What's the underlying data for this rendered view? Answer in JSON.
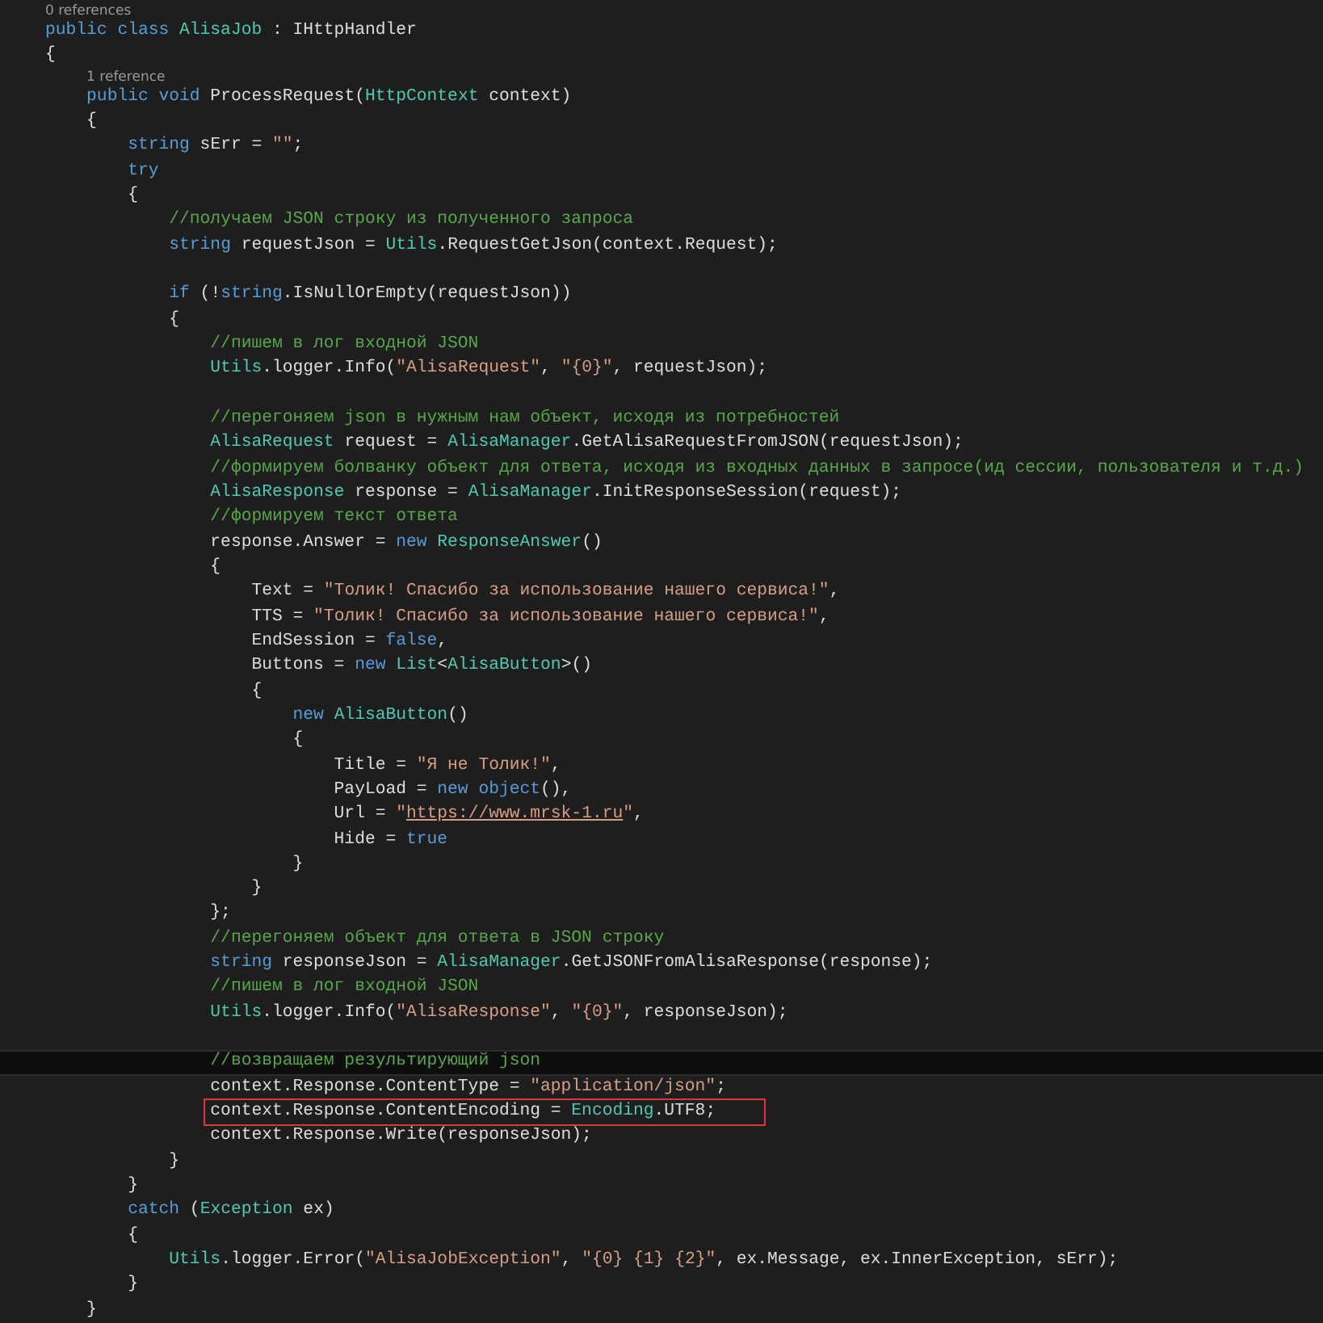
{
  "editor": {
    "lines": [
      {
        "kind": "codelens",
        "text": "0 references"
      },
      {
        "kind": "code",
        "current": false,
        "boxed": false,
        "tokens": [
          {
            "kind": "keyword",
            "text": "public class "
          },
          {
            "kind": "type",
            "text": "AlisaJob"
          },
          {
            "kind": "plain",
            "text": " : IHttpHandler"
          }
        ]
      },
      {
        "kind": "code",
        "current": false,
        "boxed": false,
        "tokens": [
          {
            "kind": "plain",
            "text": "{"
          }
        ]
      },
      {
        "kind": "codelens",
        "text": "    1 reference"
      },
      {
        "kind": "code",
        "current": false,
        "boxed": false,
        "tokens": [
          {
            "kind": "keyword",
            "text": "    public void"
          },
          {
            "kind": "plain",
            "text": " ProcessRequest("
          },
          {
            "kind": "type",
            "text": "HttpContext"
          },
          {
            "kind": "plain",
            "text": " context)"
          }
        ]
      },
      {
        "kind": "code",
        "current": false,
        "boxed": false,
        "tokens": [
          {
            "kind": "plain",
            "text": "    {"
          }
        ]
      },
      {
        "kind": "code",
        "current": false,
        "boxed": false,
        "tokens": [
          {
            "kind": "keyword",
            "text": "        string"
          },
          {
            "kind": "plain",
            "text": " sErr = "
          },
          {
            "kind": "string",
            "text": "\"\""
          },
          {
            "kind": "plain",
            "text": ";"
          }
        ]
      },
      {
        "kind": "code",
        "current": false,
        "boxed": false,
        "tokens": [
          {
            "kind": "keyword",
            "text": "        try"
          }
        ]
      },
      {
        "kind": "code",
        "current": false,
        "boxed": false,
        "tokens": [
          {
            "kind": "plain",
            "text": "        {"
          }
        ]
      },
      {
        "kind": "code",
        "current": false,
        "boxed": false,
        "tokens": [
          {
            "kind": "comment",
            "text": "            //получаем JSON строку из полученного запроса"
          }
        ]
      },
      {
        "kind": "code",
        "current": false,
        "boxed": false,
        "tokens": [
          {
            "kind": "keyword",
            "text": "            string"
          },
          {
            "kind": "plain",
            "text": " requestJson = "
          },
          {
            "kind": "type",
            "text": "Utils"
          },
          {
            "kind": "plain",
            "text": ".RequestGetJson(context.Request);"
          }
        ]
      },
      {
        "kind": "blank"
      },
      {
        "kind": "code",
        "current": false,
        "boxed": false,
        "tokens": [
          {
            "kind": "keyword",
            "text": "            if"
          },
          {
            "kind": "plain",
            "text": " (!"
          },
          {
            "kind": "keyword",
            "text": "string"
          },
          {
            "kind": "plain",
            "text": ".IsNullOrEmpty(requestJson))"
          }
        ]
      },
      {
        "kind": "code",
        "current": false,
        "boxed": false,
        "tokens": [
          {
            "kind": "plain",
            "text": "            {"
          }
        ]
      },
      {
        "kind": "code",
        "current": false,
        "boxed": false,
        "tokens": [
          {
            "kind": "comment",
            "text": "                //пишем в лог входной JSON"
          }
        ]
      },
      {
        "kind": "code",
        "current": false,
        "boxed": false,
        "tokens": [
          {
            "kind": "type",
            "text": "                Utils"
          },
          {
            "kind": "plain",
            "text": ".logger.Info("
          },
          {
            "kind": "string",
            "text": "\"AlisaRequest\""
          },
          {
            "kind": "plain",
            "text": ", "
          },
          {
            "kind": "string",
            "text": "\"{0}\""
          },
          {
            "kind": "plain",
            "text": ", requestJson);"
          }
        ]
      },
      {
        "kind": "blank"
      },
      {
        "kind": "code",
        "current": false,
        "boxed": false,
        "tokens": [
          {
            "kind": "comment",
            "text": "                //перегоняем json в нужным нам объект, исходя из потребностей"
          }
        ]
      },
      {
        "kind": "code",
        "current": false,
        "boxed": false,
        "tokens": [
          {
            "kind": "type",
            "text": "                AlisaRequest"
          },
          {
            "kind": "plain",
            "text": " request = "
          },
          {
            "kind": "type",
            "text": "AlisaManager"
          },
          {
            "kind": "plain",
            "text": ".GetAlisaRequestFromJSON(requestJson);"
          }
        ]
      },
      {
        "kind": "code",
        "current": false,
        "boxed": false,
        "tokens": [
          {
            "kind": "comment",
            "text": "                //формируем болванку объект для ответа, исходя из входных данных в запросе(ид сессии, пользователя и т.д.)"
          }
        ]
      },
      {
        "kind": "code",
        "current": false,
        "boxed": false,
        "tokens": [
          {
            "kind": "type",
            "text": "                AlisaResponse"
          },
          {
            "kind": "plain",
            "text": " response = "
          },
          {
            "kind": "type",
            "text": "AlisaManager"
          },
          {
            "kind": "plain",
            "text": ".InitResponseSession(request);"
          }
        ]
      },
      {
        "kind": "code",
        "current": false,
        "boxed": false,
        "tokens": [
          {
            "kind": "comment",
            "text": "                //формируем текст ответа"
          }
        ]
      },
      {
        "kind": "code",
        "current": false,
        "boxed": false,
        "tokens": [
          {
            "kind": "plain",
            "text": "                response.Answer = "
          },
          {
            "kind": "keyword",
            "text": "new "
          },
          {
            "kind": "type",
            "text": "ResponseAnswer"
          },
          {
            "kind": "plain",
            "text": "()"
          }
        ]
      },
      {
        "kind": "code",
        "current": false,
        "boxed": false,
        "tokens": [
          {
            "kind": "plain",
            "text": "                {"
          }
        ]
      },
      {
        "kind": "code",
        "current": false,
        "boxed": false,
        "tokens": [
          {
            "kind": "plain",
            "text": "                    Text = "
          },
          {
            "kind": "string",
            "text": "\"Толик! Спасибо за использование нашего сервиса!\""
          },
          {
            "kind": "plain",
            "text": ","
          }
        ]
      },
      {
        "kind": "code",
        "current": false,
        "boxed": false,
        "tokens": [
          {
            "kind": "plain",
            "text": "                    TTS = "
          },
          {
            "kind": "string",
            "text": "\"Толик! Спасибо за использование нашего сервиса!\""
          },
          {
            "kind": "plain",
            "text": ","
          }
        ]
      },
      {
        "kind": "code",
        "current": false,
        "boxed": false,
        "tokens": [
          {
            "kind": "plain",
            "text": "                    EndSession = "
          },
          {
            "kind": "keyword",
            "text": "false"
          },
          {
            "kind": "plain",
            "text": ","
          }
        ]
      },
      {
        "kind": "code",
        "current": false,
        "boxed": false,
        "tokens": [
          {
            "kind": "plain",
            "text": "                    Buttons = "
          },
          {
            "kind": "keyword",
            "text": "new "
          },
          {
            "kind": "type",
            "text": "List"
          },
          {
            "kind": "plain",
            "text": "<"
          },
          {
            "kind": "type",
            "text": "AlisaButton"
          },
          {
            "kind": "plain",
            "text": ">()"
          }
        ]
      },
      {
        "kind": "code",
        "current": false,
        "boxed": false,
        "tokens": [
          {
            "kind": "plain",
            "text": "                    {"
          }
        ]
      },
      {
        "kind": "code",
        "current": false,
        "boxed": false,
        "tokens": [
          {
            "kind": "keyword",
            "text": "                        new "
          },
          {
            "kind": "type",
            "text": "AlisaButton"
          },
          {
            "kind": "plain",
            "text": "()"
          }
        ]
      },
      {
        "kind": "code",
        "current": false,
        "boxed": false,
        "tokens": [
          {
            "kind": "plain",
            "text": "                        {"
          }
        ]
      },
      {
        "kind": "code",
        "current": false,
        "boxed": false,
        "tokens": [
          {
            "kind": "plain",
            "text": "                            Title = "
          },
          {
            "kind": "string",
            "text": "\"Я не Толик!\""
          },
          {
            "kind": "plain",
            "text": ","
          }
        ]
      },
      {
        "kind": "code",
        "current": false,
        "boxed": false,
        "tokens": [
          {
            "kind": "plain",
            "text": "                            PayLoad = "
          },
          {
            "kind": "keyword",
            "text": "new object"
          },
          {
            "kind": "plain",
            "text": "(),"
          }
        ]
      },
      {
        "kind": "code",
        "current": false,
        "boxed": false,
        "tokens": [
          {
            "kind": "plain",
            "text": "                            Url = "
          },
          {
            "kind": "string",
            "text": "\""
          },
          {
            "kind": "link",
            "text": "https://www.mrsk-1.ru"
          },
          {
            "kind": "string",
            "text": "\""
          },
          {
            "kind": "plain",
            "text": ","
          }
        ]
      },
      {
        "kind": "code",
        "current": false,
        "boxed": false,
        "tokens": [
          {
            "kind": "plain",
            "text": "                            Hide = "
          },
          {
            "kind": "keyword",
            "text": "true"
          }
        ]
      },
      {
        "kind": "code",
        "current": false,
        "boxed": false,
        "tokens": [
          {
            "kind": "plain",
            "text": "                        }"
          }
        ]
      },
      {
        "kind": "code",
        "current": false,
        "boxed": false,
        "tokens": [
          {
            "kind": "plain",
            "text": "                    }"
          }
        ]
      },
      {
        "kind": "code",
        "current": false,
        "boxed": false,
        "tokens": [
          {
            "kind": "plain",
            "text": "                };"
          }
        ]
      },
      {
        "kind": "code",
        "current": false,
        "boxed": false,
        "tokens": [
          {
            "kind": "comment",
            "text": "                //перегоняем объект для ответа в JSON строку"
          }
        ]
      },
      {
        "kind": "code",
        "current": false,
        "boxed": false,
        "tokens": [
          {
            "kind": "keyword",
            "text": "                string"
          },
          {
            "kind": "plain",
            "text": " responseJson = "
          },
          {
            "kind": "type",
            "text": "AlisaManager"
          },
          {
            "kind": "plain",
            "text": ".GetJSONFromAlisaResponse(response);"
          }
        ]
      },
      {
        "kind": "code",
        "current": false,
        "boxed": false,
        "tokens": [
          {
            "kind": "comment",
            "text": "                //пишем в лог входной JSON"
          }
        ]
      },
      {
        "kind": "code",
        "current": false,
        "boxed": false,
        "tokens": [
          {
            "kind": "type",
            "text": "                Utils"
          },
          {
            "kind": "plain",
            "text": ".logger.Info("
          },
          {
            "kind": "string",
            "text": "\"AlisaResponse\""
          },
          {
            "kind": "plain",
            "text": ", "
          },
          {
            "kind": "string",
            "text": "\"{0}\""
          },
          {
            "kind": "plain",
            "text": ", responseJson);"
          }
        ]
      },
      {
        "kind": "blank"
      },
      {
        "kind": "code",
        "current": true,
        "boxed": false,
        "tokens": [
          {
            "kind": "comment",
            "text": "                //возвращаем результирующий json"
          }
        ]
      },
      {
        "kind": "code",
        "current": false,
        "boxed": false,
        "tokens": [
          {
            "kind": "plain",
            "text": "                context.Response.ContentType = "
          },
          {
            "kind": "string",
            "text": "\"application/json\""
          },
          {
            "kind": "plain",
            "text": ";"
          }
        ]
      },
      {
        "kind": "code",
        "current": false,
        "boxed": true,
        "tokens": [
          {
            "kind": "plain",
            "text": "                context.Response.ContentEncoding = "
          },
          {
            "kind": "type",
            "text": "Encoding"
          },
          {
            "kind": "plain",
            "text": ".UTF8;"
          }
        ]
      },
      {
        "kind": "code",
        "current": false,
        "boxed": false,
        "tokens": [
          {
            "kind": "plain",
            "text": "                context.Response.Write(responseJson);"
          }
        ]
      },
      {
        "kind": "code",
        "current": false,
        "boxed": false,
        "tokens": [
          {
            "kind": "plain",
            "text": "            }"
          }
        ]
      },
      {
        "kind": "code",
        "current": false,
        "boxed": false,
        "tokens": [
          {
            "kind": "plain",
            "text": "        }"
          }
        ]
      },
      {
        "kind": "code",
        "current": false,
        "boxed": false,
        "tokens": [
          {
            "kind": "keyword",
            "text": "        catch"
          },
          {
            "kind": "plain",
            "text": " ("
          },
          {
            "kind": "type",
            "text": "Exception"
          },
          {
            "kind": "plain",
            "text": " ex)"
          }
        ]
      },
      {
        "kind": "code",
        "current": false,
        "boxed": false,
        "tokens": [
          {
            "kind": "plain",
            "text": "        {"
          }
        ]
      },
      {
        "kind": "code",
        "current": false,
        "boxed": false,
        "tokens": [
          {
            "kind": "type",
            "text": "            Utils"
          },
          {
            "kind": "plain",
            "text": ".logger.Error("
          },
          {
            "kind": "string",
            "text": "\"AlisaJobException\""
          },
          {
            "kind": "plain",
            "text": ", "
          },
          {
            "kind": "string",
            "text": "\"{0} {1} {2}\""
          },
          {
            "kind": "plain",
            "text": ", ex.Message, ex.InnerException, sErr);"
          }
        ]
      },
      {
        "kind": "code",
        "current": false,
        "boxed": false,
        "tokens": [
          {
            "kind": "plain",
            "text": "        }"
          }
        ]
      },
      {
        "kind": "code",
        "current": false,
        "boxed": false,
        "tokens": [
          {
            "kind": "plain",
            "text": "    }"
          }
        ]
      }
    ]
  }
}
